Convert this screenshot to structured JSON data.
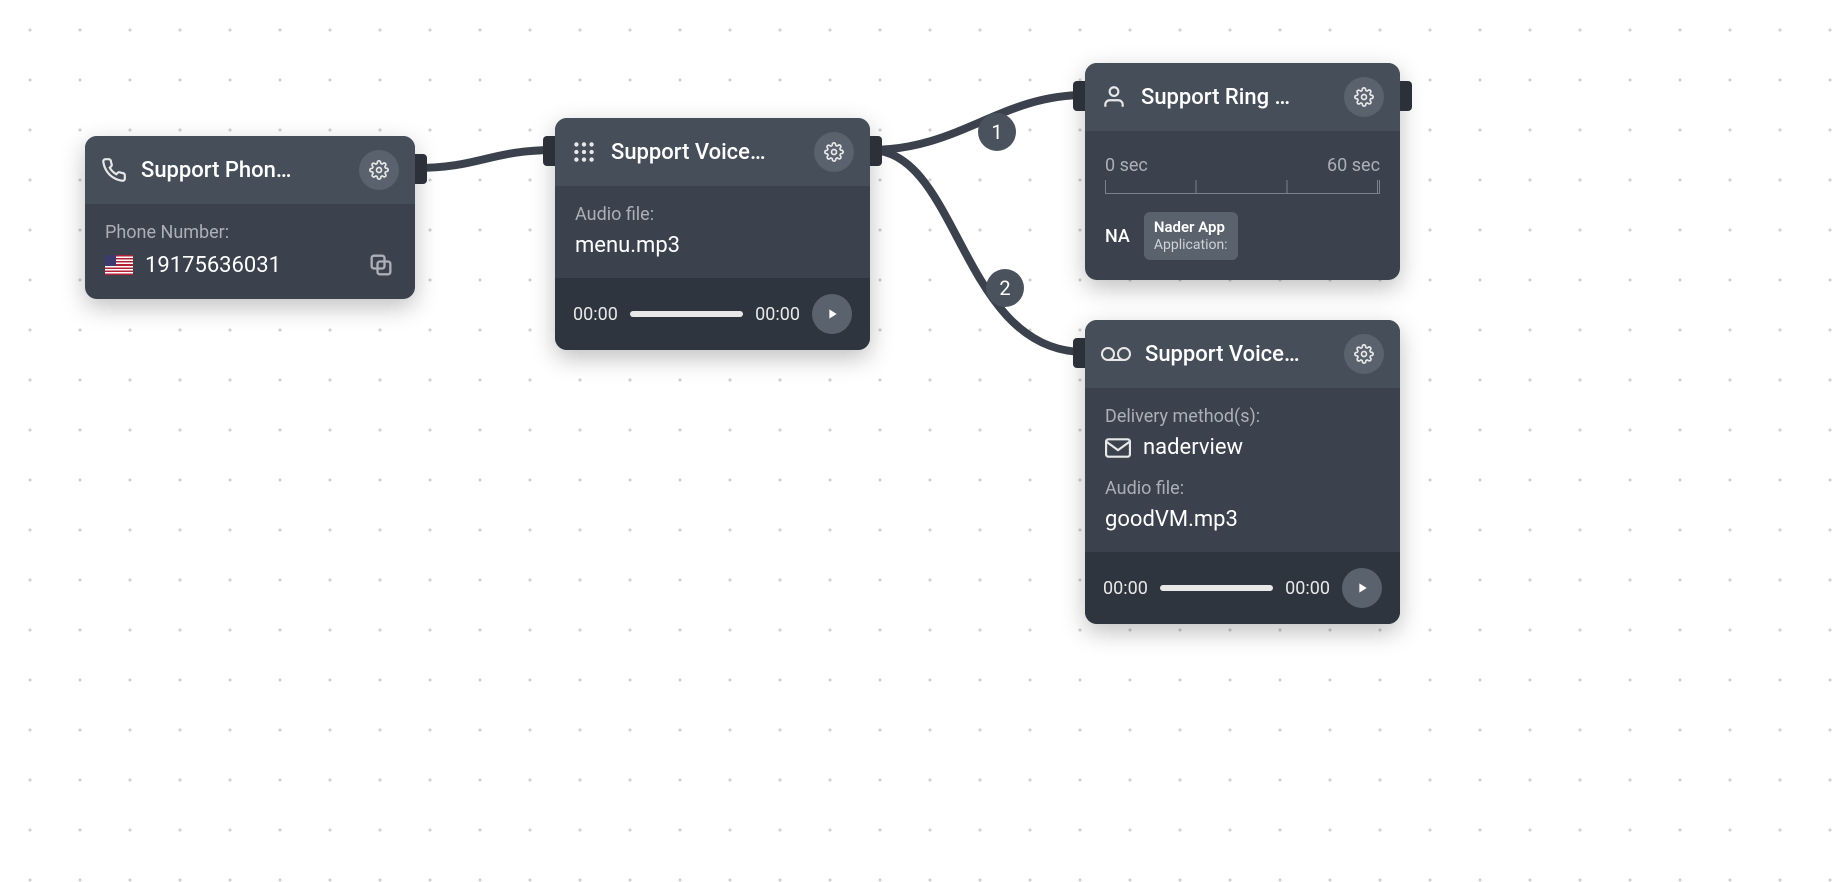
{
  "nodes": {
    "phone": {
      "title": "Support Phon…",
      "label": "Phone Number:",
      "number": "19175636031"
    },
    "menu": {
      "title": "Support Voice…",
      "audio_label": "Audio file:",
      "audio_file": "menu.mp3",
      "time_start": "00:00",
      "time_end": "00:00"
    },
    "ring": {
      "title": "Support Ring …",
      "ruler_start": "0 sec",
      "ruler_end": "60 sec",
      "avatar_initials": "NA",
      "app_name": "Nader App",
      "app_sub": "Application:"
    },
    "vm": {
      "title": "Support Voice…",
      "delivery_label": "Delivery method(s):",
      "delivery_value": "naderview",
      "audio_label": "Audio file:",
      "audio_file": "goodVM.mp3",
      "time_start": "00:00",
      "time_end": "00:00"
    }
  },
  "badges": {
    "one": "1",
    "two": "2"
  }
}
